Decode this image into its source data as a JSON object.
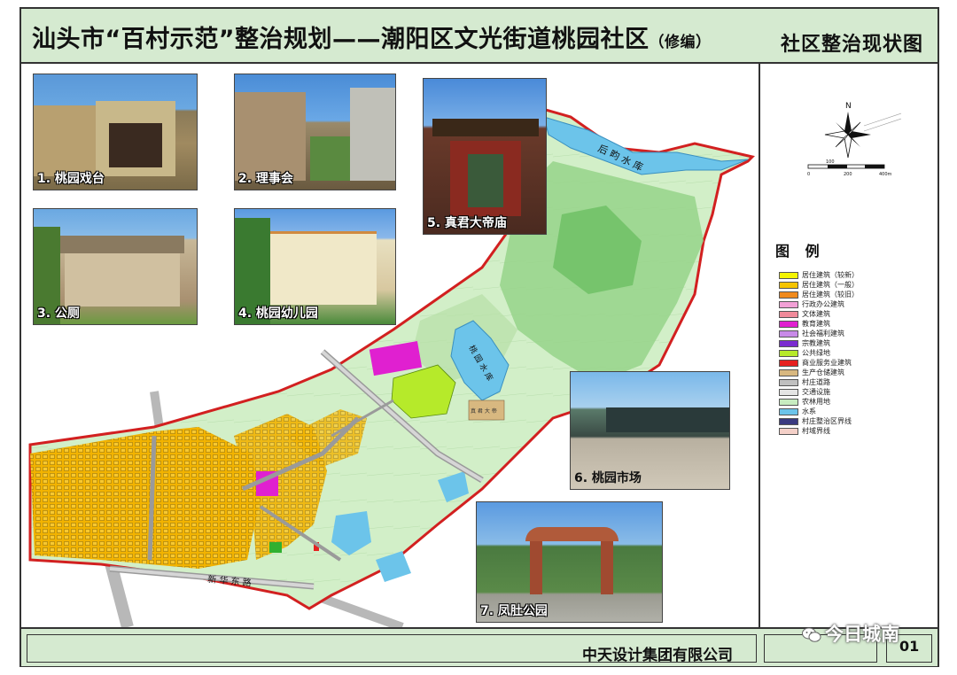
{
  "header": {
    "title_main": "汕头市“百村示范”整治规划——潮阳区文光街道桃园社区",
    "title_sub": "（修编）",
    "map_title": "社区整治现状图"
  },
  "photos": [
    {
      "caption": "1. 桃园戏台",
      "icon": "stage-building-photo"
    },
    {
      "caption": "2. 理事会",
      "icon": "council-building-photo"
    },
    {
      "caption": "3. 公厕",
      "icon": "public-toilet-photo"
    },
    {
      "caption": "4. 桃园幼儿园",
      "icon": "kindergarten-photo"
    },
    {
      "caption": "5. 真君大帝庙",
      "icon": "temple-photo"
    },
    {
      "caption": "6. 桃园市场",
      "icon": "market-photo"
    },
    {
      "caption": "7. 凤肚公园",
      "icon": "park-gate-photo"
    }
  ],
  "map": {
    "labels": {
      "reservoir_north": "后 畇 水 库",
      "reservoir_taoyuan": "桃 园 水 库",
      "road_south": "新  华  东  路",
      "temple_sign": "真 君 大 帝"
    }
  },
  "compass": {
    "north": "N",
    "scale_top": "100",
    "scale_labels": [
      "0",
      "200",
      "400m"
    ]
  },
  "legend": {
    "title": "图 例",
    "items": [
      {
        "label": "居住建筑（较新）",
        "color": "#f4f400"
      },
      {
        "label": "居住建筑（一般）",
        "color": "#f5c400"
      },
      {
        "label": "居住建筑（较旧）",
        "color": "#f08a1c"
      },
      {
        "label": "行政办公建筑",
        "color": "#f2a0d6"
      },
      {
        "label": "文体建筑",
        "color": "#f08a9a"
      },
      {
        "label": "教育建筑",
        "color": "#e020d0"
      },
      {
        "label": "社会福利建筑",
        "color": "#c88ae8"
      },
      {
        "label": "宗教建筑",
        "color": "#7a2ad0"
      },
      {
        "label": "公共绿地",
        "color": "#b6ea2a"
      },
      {
        "label": "商业服务业建筑",
        "color": "#e62020"
      },
      {
        "label": "生产仓储建筑",
        "color": "#d8b880"
      },
      {
        "label": "村庄道路",
        "color": "#c0c0c0"
      },
      {
        "label": "交通设施",
        "color": "#e4e4e4"
      },
      {
        "label": "农林用地",
        "color": "#c8ecc0"
      },
      {
        "label": "水系",
        "color": "#6cc4ea"
      },
      {
        "label": "村庄整治区界线",
        "color": "#3a3a80"
      },
      {
        "label": "村域界线",
        "color": "#f4d0c8"
      }
    ]
  },
  "footer": {
    "company": "中天设计集团有限公司",
    "page_number": "01"
  },
  "watermark": {
    "text": "今日城南"
  }
}
